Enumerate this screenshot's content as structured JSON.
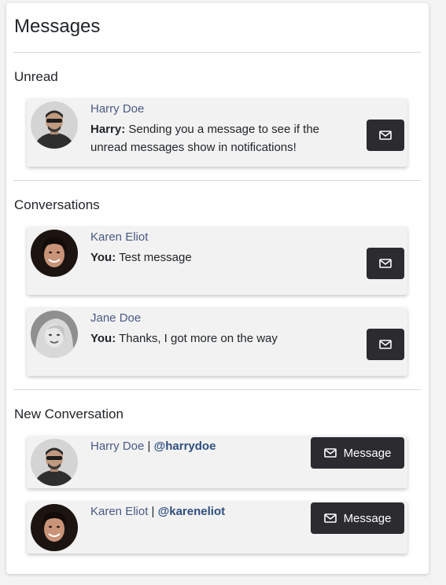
{
  "panel": {
    "title": "Messages"
  },
  "unread": {
    "title": "Unread",
    "items": [
      {
        "name": "Harry Doe",
        "sender": "Harry:",
        "text": "Sending you a message to see if the unread messages show in notifications!",
        "icon": "envelope-icon"
      }
    ]
  },
  "conversations": {
    "title": "Conversations",
    "items": [
      {
        "name": "Karen Eliot",
        "sender": "You:",
        "text": "Test message",
        "icon": "envelope-icon"
      },
      {
        "name": "Jane Doe",
        "sender": "You:",
        "text": "Thanks, I got more on the way",
        "icon": "envelope-icon"
      }
    ]
  },
  "new_conversation": {
    "title": "New Conversation",
    "separator": "|",
    "button_label": "Message",
    "items": [
      {
        "name": "Harry Doe",
        "handle": "@harrydoe"
      },
      {
        "name": "Karen Eliot",
        "handle": "@kareneliot"
      }
    ]
  }
}
